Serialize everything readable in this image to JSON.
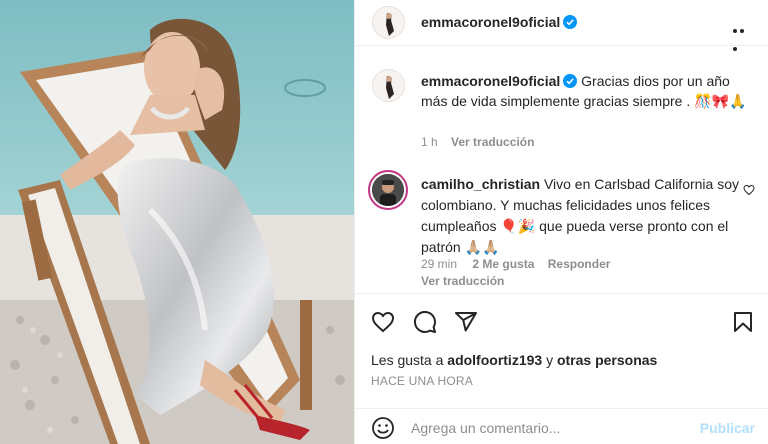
{
  "post": {
    "author": "emmacoronel9oficial",
    "verified": true,
    "caption": "Gracias dios por un año más de vida simplemente gracias siempre . 🎊🎀🙏",
    "caption_time": "1 h",
    "view_translation": "Ver traducción",
    "image_description_icon": "photo"
  },
  "comment": {
    "author": "camilho_christian",
    "text": "Vivo en Carlsbad California soy colombiano. Y muchas felicidades unos felices cumpleaños 🎈🎉 que pueda verse pronto con el patrón 🙏🏼🙏🏼",
    "time": "29 min",
    "likes": "2 Me gusta",
    "reply": "Responder",
    "view_translation": "Ver traducción"
  },
  "actions": {
    "icons": [
      "heart-icon",
      "comment-icon",
      "share-icon",
      "bookmark-icon"
    ],
    "likes_prefix": "Les gusta a ",
    "likes_user": "adolfoortiz193",
    "likes_middle": " y ",
    "likes_others": "otras personas",
    "timestamp": "HACE UNA HORA"
  },
  "add_comment": {
    "placeholder": "Agrega un comentario...",
    "publish_label": "Publicar"
  },
  "colors": {
    "verified_blue": "#0095f6",
    "publish_disabled": "#b2dffc",
    "muted": "#8e8e8e",
    "story_ring": "#c13584"
  }
}
